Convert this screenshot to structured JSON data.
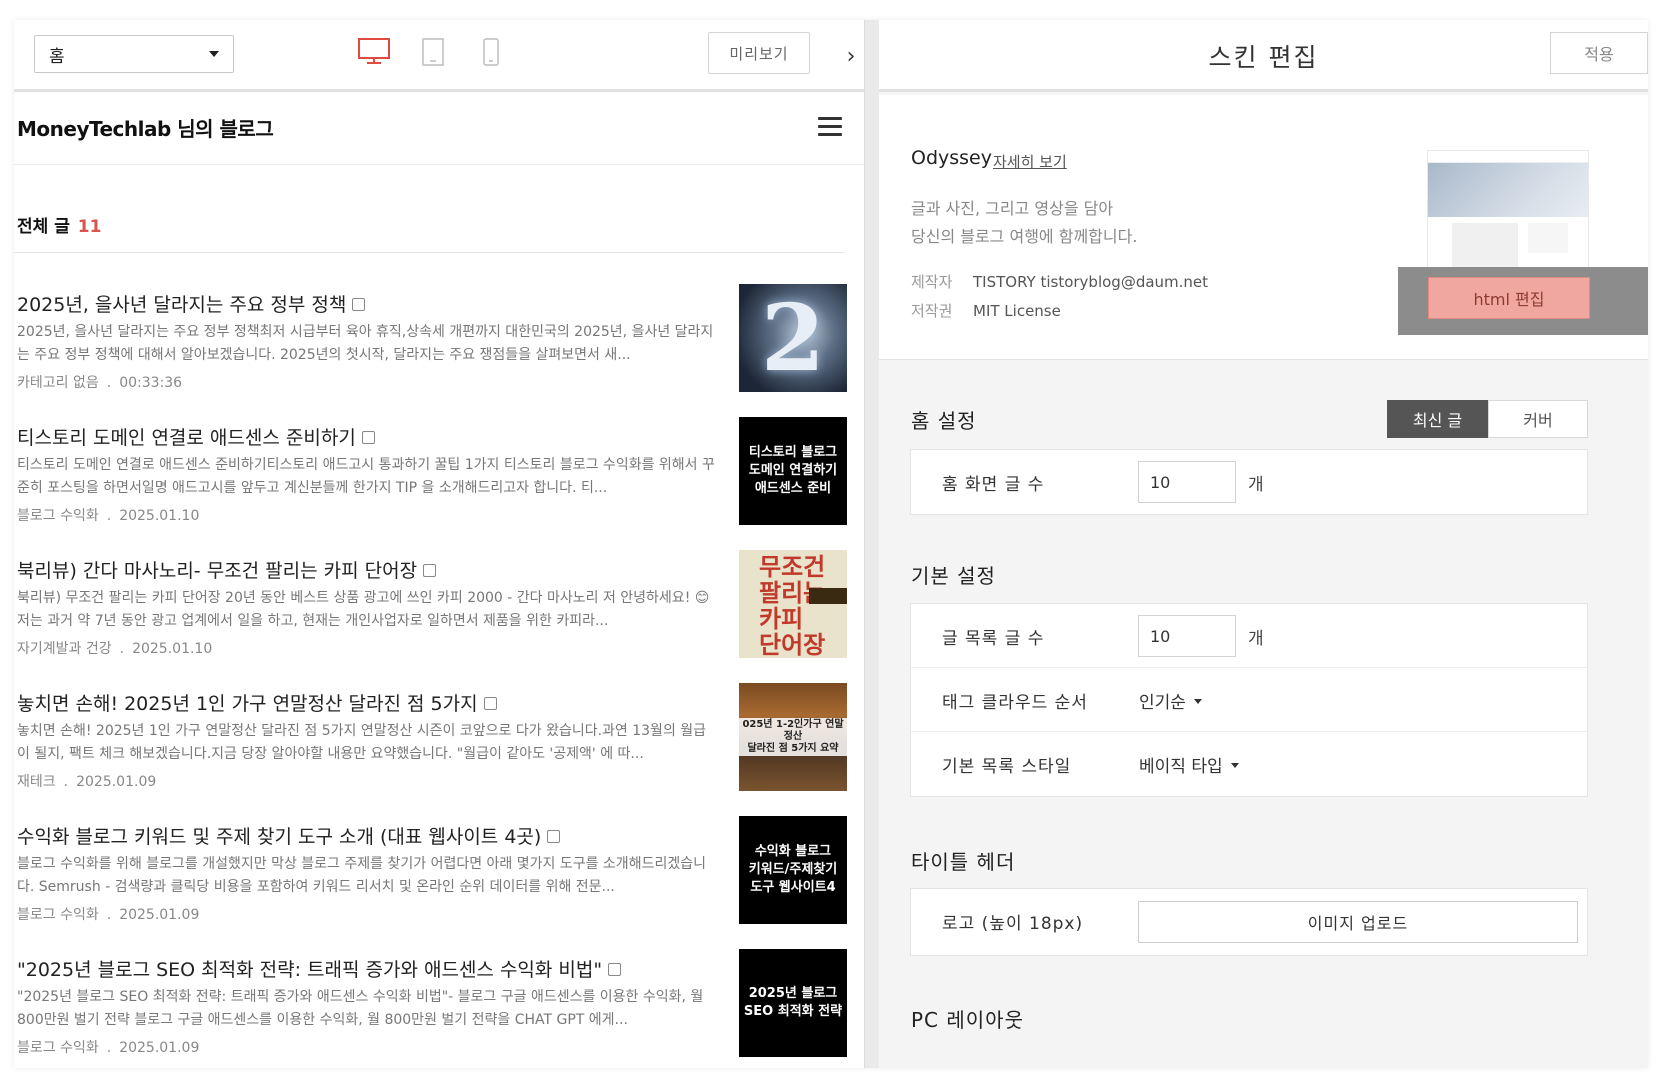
{
  "left": {
    "page_select": "홈",
    "preview_label": "미리보기",
    "collapse_icon": "›",
    "blog_title": "MoneyTechlab 님의 블로그",
    "total_label": "전체 글",
    "total_count": "11",
    "posts": [
      {
        "title": "2025년, 을사년 달라지는 주요 정부 정책",
        "excerpt": "2025년, 을사년 달라지는 주요 정부 정책최저 시급부터 육아 휴직,상속세 개편까지 대한민국의 2025년, 을사년 달라지는 주요 정부 정책에 대해서 알아보겠습니다. 2025년의 첫시작, 달라지는 주요 쟁점들을 살펴보면서 새...",
        "category": "카테고리 없음",
        "date": "00:33:36",
        "thumb": "2"
      },
      {
        "title": "티스토리 도메인 연결로 애드센스 준비하기",
        "excerpt": "티스토리 도메인 연결로 애드센스 준비하기티스토리 애드고시 통과하기 꿀팁 1가지 티스토리 블로그 수익화를 위해서 꾸준히 포스팅을 하면서일명 애드고시를 앞두고 계신분들께 한가지 TIP 을 소개해드리고자 합니다. 티...",
        "category": "블로그 수익화",
        "date": "2025.01.10",
        "thumb": "티스토리 블로그\n도메인 연결하기\n애드센스 준비"
      },
      {
        "title": "북리뷰) 간다 마사노리- 무조건 팔리는 카피 단어장",
        "excerpt": "북리뷰) 무조건 팔리는 카피 단어장 20년 동안 베스트 상품 광고에 쓰인 카피 2000 - 간다 마사노리 저 안녕하세요! 😊 저는 과거 약 7년 동안 광고 업계에서 일을 하고, 현재는 개인사업자로 일하면서 제품을 위한 카피라...",
        "category": "자기계발과 건강",
        "date": "2025.01.10",
        "thumb": "무조건\n팔리는\n카피\n단어장"
      },
      {
        "title": "놓치면 손해! 2025년 1인 가구 연말정산 달라진 점 5가지",
        "excerpt": "놓치면 손해! 2025년 1인 가구 연말정산 달라진 점 5가지 연말정산 시즌이 코앞으로 다가 왔습니다.과연 13월의 월급이 될지, 팩트 체크 해보겠습니다.지금 당장 알아야할 내용만 요약했습니다. \"월급이 같아도 '공제액' 에 따...",
        "category": "재테크",
        "date": "2025.01.09",
        "thumb": "025년 1-2인가구 연말정산\n달라진 점 5가지 요약"
      },
      {
        "title": "수익화 블로그 키워드 및 주제 찾기 도구 소개 (대표 웹사이트 4곳)",
        "excerpt": "블로그 수익화를 위해 블로그를 개설했지만 막상 블로그 주제를 찾기가 어렵다면 아래 몇가지 도구를 소개해드리겠습니다. Semrush - 검색량과 클릭당 비용을 포함하여 키워드 리서치 및 온라인 순위 데이터를 위해 전문...",
        "category": "블로그 수익화",
        "date": "2025.01.09",
        "thumb": "수익화 블로그\n키워드/주제찾기\n도구 웹사이트4"
      },
      {
        "title": "\"2025년 블로그 SEO 최적화 전략: 트래픽 증가와 애드센스 수익화 비법\"",
        "excerpt": "\"2025년 블로그 SEO 최적화 전략: 트래픽 증가와 애드센스 수익화 비법\"- 블로그 구글 애드센스를 이용한 수익화, 월 800만원 벌기 전략 블로그 구글 애드센스를 이용한 수익화, 월 800만원 벌기 전략을 CHAT GPT 에게...",
        "category": "블로그 수익화",
        "date": "2025.01.09",
        "thumb": "2025년 블로그\nSEO 최적화 전략"
      }
    ]
  },
  "right": {
    "title": "스킨 편집",
    "apply_label": "적용",
    "skin_name": "Odyssey",
    "detail_link": "자세히 보기",
    "desc_line1": "글과 사진, 그리고 영상을 담아",
    "desc_line2": "당신의 블로그 여행에 함께합니다.",
    "maker_key": "제작자",
    "maker_val": "TISTORY  tistoryblog@daum.net",
    "license_key": "저작권",
    "license_val": "MIT License",
    "html_edit_label": "html 편집",
    "home_section": "홈 설정",
    "toggle_on": "최신 글",
    "toggle_off": "커버",
    "home_count_label": "홈 화면 글 수",
    "home_count_value": "10",
    "unit": "개",
    "basic_section": "기본 설정",
    "list_count_label": "글 목록 글 수",
    "list_count_value": "10",
    "tag_order_label": "태그 클라우드 순서",
    "tag_order_value": "인기순",
    "list_style_label": "기본 목록 스타일",
    "list_style_value": "베이직 타입",
    "title_header_section": "타이틀 헤더",
    "logo_label": "로고 (높이 18px)",
    "upload_label": "이미지 업로드",
    "pc_layout_section": "PC 레이아웃"
  },
  "colors": {
    "count_red": "#d9534f",
    "toggle_active": "#555555",
    "html_edit_bg": "#f0a7a0"
  }
}
